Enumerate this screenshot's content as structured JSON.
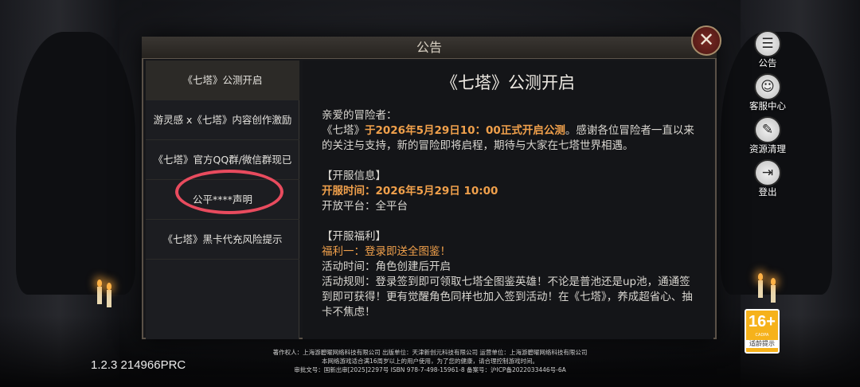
{
  "dialog": {
    "title": "公告",
    "close_label": "✕"
  },
  "tabs": [
    {
      "label": "《七塔》公测开启",
      "active": true
    },
    {
      "label": "游灵感 x《七塔》内容创作激励"
    },
    {
      "label": "《七塔》官方QQ群/微信群现已"
    },
    {
      "label": "公平****声明"
    },
    {
      "label": "《七塔》黑卡代充风险提示"
    }
  ],
  "content": {
    "title": "《七塔》公测开启",
    "greeting": "亲爱的冒险者：",
    "intro_prefix": "《七塔》",
    "intro_highlight": "于2026年5月29日10：00正式开启公测",
    "intro_suffix": "。感谢各位冒险者一直以来的关注与支持，新的冒险即将启程，期待与大家在七塔世界相遇。",
    "open_info_heading": "【开服信息】",
    "open_time": "开服时间：2026年5月29日 10:00",
    "open_platform": "开放平台：全平台",
    "benefits_heading": "【开服福利】",
    "benefit1_title": "福利一：登录即送全图鉴！",
    "activity_time": "活动时间：角色创建后开启",
    "activity_rules": "活动规则：登录签到即可领取七塔全图鉴英雄！不论是普池还是up池，通通签到即可获得！更有觉醒角色同样也加入签到活动！在《七塔》，养成超省心、抽卡不焦虑！"
  },
  "side_menu": [
    {
      "label": "公告",
      "icon": "notice-icon"
    },
    {
      "label": "客服中心",
      "icon": "support-icon"
    },
    {
      "label": "资源清理",
      "icon": "broom-icon"
    },
    {
      "label": "登出",
      "icon": "logout-icon"
    }
  ],
  "version": "1.2.3 214966PRC",
  "footer": {
    "line1": "著作权人：上海游碧曜网络科技有限公司 出版单位：天津新创元科技有限公司 运营单位：上海游碧曜网络科技有限公司",
    "line2": "本网络游戏适合满16周岁以上的用户使用，为了您的健康，请合理控制游戏时间。",
    "line3": "审批文号：国新出审[2025]2297号   ISBN 978-7-498-15961-8   备案号：沪ICP备2022033446号-6A"
  },
  "age_rating": {
    "number": "16+",
    "sub": "CADPA",
    "label": "适龄提示"
  },
  "colors": {
    "highlight": "#f0a04b",
    "annotation": "#e84b5e",
    "badge": "#f6b21b"
  }
}
